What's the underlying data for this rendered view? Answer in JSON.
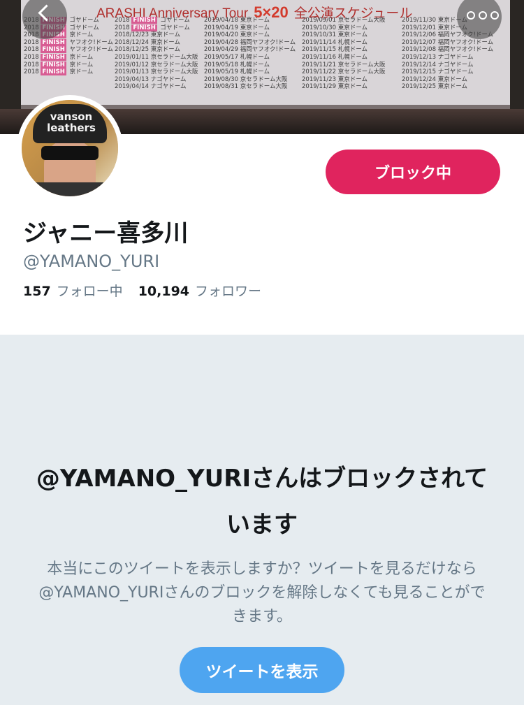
{
  "banner": {
    "heading_en": "ARASHI Anniversary Tour",
    "heading_num": "5×20",
    "heading_jp": "全公演スケジュール",
    "columns": [
      [
        "2018 FINISH ゴヤドーム",
        "2018 FINISH ゴヤドーム",
        "2018 FINISH 京ドーム",
        "2018 FINISH ヤフオク!ドーム",
        "2018 FINISH ヤフオク!ドーム",
        "2018 FINISH 京ドーム",
        "2018 FINISH 京ドーム",
        "2018 FINISH 京ドーム"
      ],
      [
        "2018 FINISH ゴヤドーム",
        "2018 FINISH ゴヤドーム",
        "2018/12/23 東京ドーム",
        "2018/12/24 東京ドーム",
        "2018/12/25 東京ドーム",
        "2019/01/11 京セラドーム大阪",
        "2019/01/12 京セラドーム大阪",
        "2019/01/13 京セラドーム大阪",
        "2019/04/13 ナゴヤドーム",
        "2019/04/14 ナゴヤドーム"
      ],
      [
        "2019/04/18 東京ドーム",
        "2019/04/19 東京ドーム",
        "2019/04/20 東京ドーム",
        "2019/04/28 福岡ヤフオク!ドーム",
        "2019/04/29 福岡ヤフオク!ドーム",
        "2019/05/17 札幌ドーム",
        "2019/05/18 札幌ドーム",
        "2019/05/19 札幌ドーム",
        "2019/08/30 京セラドーム大阪",
        "2019/08/31 京セラドーム大阪"
      ],
      [
        "2019/09/01 京セラドーム大阪",
        "2019/10/30 東京ドーム",
        "2019/10/31 東京ドーム",
        "2019/11/14 札幌ドーム",
        "2019/11/15 札幌ドーム",
        "2019/11/16 札幌ドーム",
        "2019/11/21 京セラドーム大阪",
        "2019/11/22 京セラドーム大阪",
        "2019/11/23 東京ドーム",
        "2019/11/29 東京ドーム"
      ],
      [
        "2019/11/30 東京ドーム",
        "2019/12/01 東京ドーム",
        "2019/12/06 福岡ヤフオク!ドーム",
        "2019/12/07 福岡ヤフオク!ドーム",
        "2019/12/08 福岡ヤフオク!ドーム",
        "2019/12/13 ナゴヤドーム",
        "2019/12/14 ナゴヤドーム",
        "2019/12/15 ナゴヤドーム",
        "2019/12/24 東京ドーム",
        "2019/12/25 東京ドーム"
      ]
    ]
  },
  "avatar": {
    "hat_text": "vanson leathers"
  },
  "profile": {
    "block_button_label": "ブロック中",
    "name": "ジャニー喜多川",
    "handle": "@YAMANO_YURI",
    "following_count": "157",
    "following_label": "フォロー中",
    "followers_count": "10,194",
    "followers_label": "フォロワー"
  },
  "blocked": {
    "title": "@YAMANO_YURIさんはブロックされています",
    "description": "本当にこのツイートを表示しますか？ツイートを見るだけなら@YAMANO_YURIさんのブロックを解除しなくても見ることができます。",
    "show_button_label": "ツイートを表示"
  },
  "colors": {
    "block_button": "#e0245e",
    "show_button": "#4ea5f0",
    "secondary_text": "#657786",
    "background": "#e6ecf0"
  },
  "icons": {
    "back": "chevron-left-icon",
    "more": "more-dots-icon"
  }
}
